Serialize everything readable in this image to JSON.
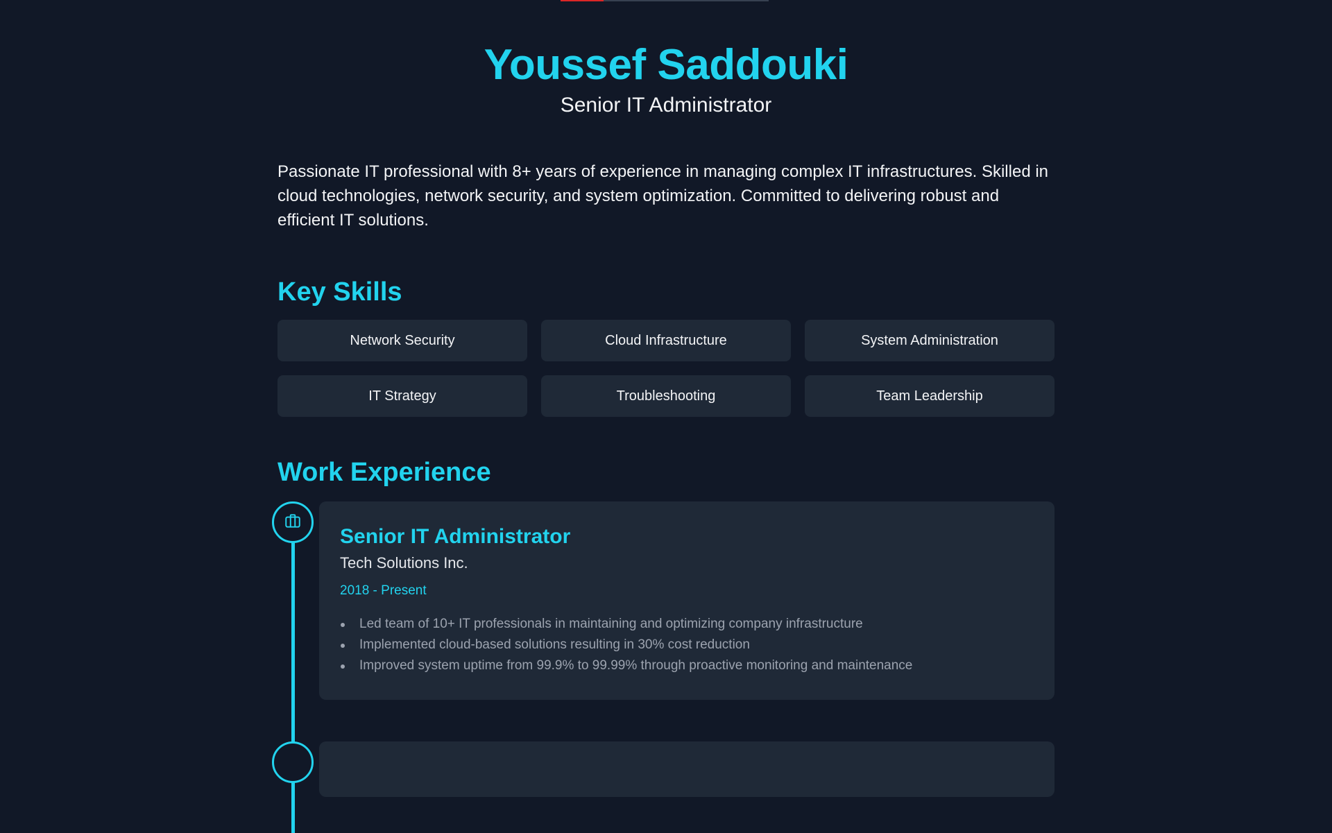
{
  "colors": {
    "accent": "#22d3ee",
    "background": "#111827",
    "card": "#1f2937",
    "indicator_active": "#dc2626"
  },
  "header": {
    "name": "Youssef Saddouki",
    "role": "Senior IT Administrator"
  },
  "summary": "Passionate IT professional with 8+ years of experience in managing complex IT infrastructures. Skilled in cloud technologies, network security, and system optimization. Committed to delivering robust and efficient IT solutions.",
  "skills": {
    "title": "Key Skills",
    "items": [
      "Network Security",
      "Cloud Infrastructure",
      "System Administration",
      "IT Strategy",
      "Troubleshooting",
      "Team Leadership"
    ]
  },
  "work": {
    "title": "Work Experience",
    "jobs": [
      {
        "icon": "briefcase-icon",
        "title": "Senior IT Administrator",
        "company": "Tech Solutions Inc.",
        "dates": "2018 - Present",
        "bullets": [
          "Led team of 10+ IT professionals in maintaining and optimizing company infrastructure",
          "Implemented cloud-based solutions resulting in 30% cost reduction",
          "Improved system uptime from 99.9% to 99.99% through proactive monitoring and maintenance"
        ]
      }
    ]
  }
}
